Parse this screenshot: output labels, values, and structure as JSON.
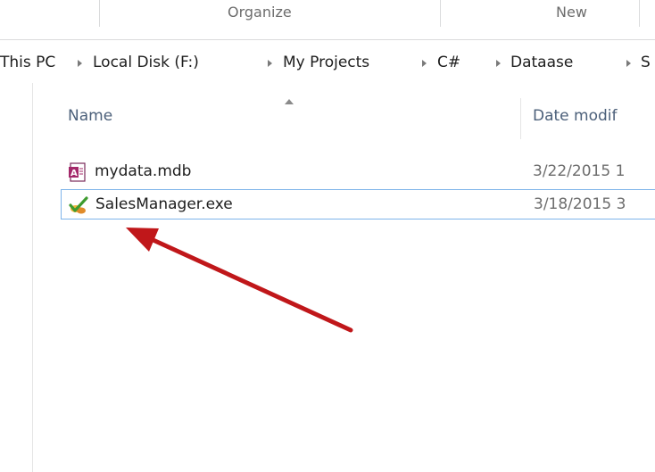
{
  "ribbon": {
    "groups": [
      {
        "label": "Organize"
      },
      {
        "label": "New"
      }
    ]
  },
  "address_bar": {
    "crumbs": [
      "This PC",
      "Local Disk (F:)",
      "My Projects",
      "C#",
      "Dataase",
      "S"
    ]
  },
  "columns": {
    "name": "Name",
    "date": "Date modif"
  },
  "files": [
    {
      "name": "mydata.mdb",
      "date": "3/22/2015 1",
      "icon": "access-database-icon"
    },
    {
      "name": "SalesManager.exe",
      "date": "3/18/2015 3",
      "icon": "sales-app-icon",
      "selected": true
    }
  ],
  "annotation": {
    "color": "#c0171a",
    "icon": "red-pointer-arrow"
  }
}
